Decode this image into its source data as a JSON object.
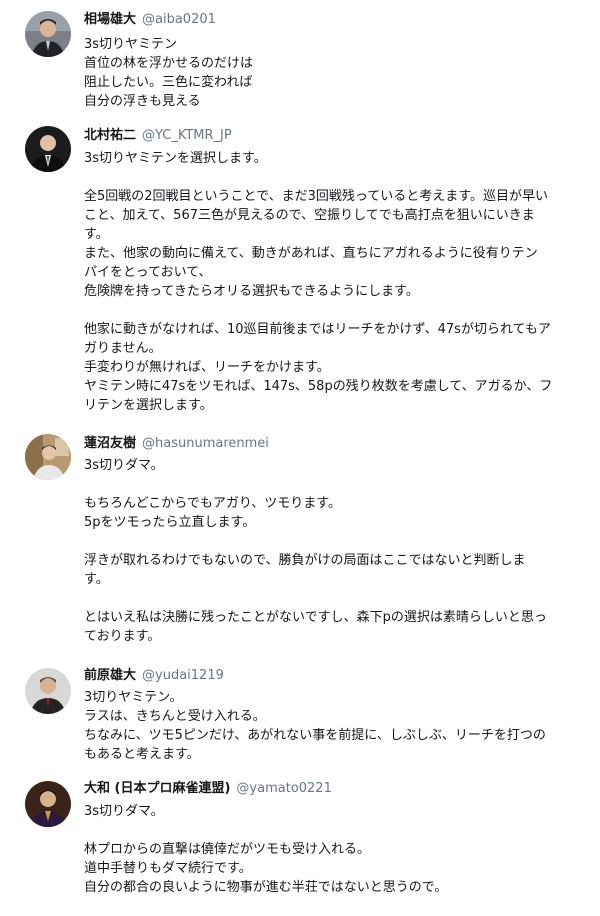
{
  "tweets": [
    {
      "name": "相場雄大",
      "handle": "@aiba0201",
      "avatar": "avatar-man-suit",
      "lines": [
        "3s切りヤミテン",
        "首位の林を浮かせるのだけは",
        "阻止したい。三色に変われば",
        "自分の浮きも見える"
      ]
    },
    {
      "name": "北村祐二",
      "handle": "@YC_KTMR_JP",
      "avatar": "avatar-man-dark-suit",
      "lines": [
        "3s切りヤミテンを選択します。",
        "",
        "全5回戦の2回戦目ということで、まだ3回戦残っていると考えます。巡目が早い",
        "こと、加えて、567三色が見えるので、空振りしてでも高打点を狙いにいきま",
        "す。",
        "また、他家の動向に備えて、動きがあれば、直ちにアガれるように役有りテン",
        "パイをとっておいて、",
        "危険牌を持ってきたらオリる選択もできるようにします。",
        "",
        "他家に動きがなければ、10巡目前後まではリーチをかけず、47sが切られてもア",
        "ガりません。",
        "手変わりが無ければ、リーチをかけます。",
        "ヤミテン時に47sをツモれば、147s、58pの残り枚数を考慮して、アガるか、フ",
        "リテンを選択します。"
      ]
    },
    {
      "name": "蓮沼友樹",
      "handle": "@hasunumarenmei",
      "avatar": "avatar-man-room",
      "lines": [
        "3s切りダマ。",
        "",
        "もちろんどこからでもアガり、ツモります。",
        "5pをツモったら立直します。",
        "",
        "浮きが取れるわけでもないので、勝負がけの局面はここではないと判断しま",
        "す。",
        "",
        "とはいえ私は決勝に残ったことがないですし、森下pの選択は素晴らしいと思っ",
        "ております。"
      ]
    },
    {
      "name": "前原雄大",
      "handle": "@yudai1219",
      "avatar": "avatar-man-older",
      "lines": [
        "3切りヤミテン。",
        "ラスは、きちんと受け入れる。",
        "ちなみに、ツモ5ピンだけ、あがれない事を前提に、しぶしぶ、リーチを打つの",
        "もあると考えます。"
      ]
    },
    {
      "name": "大和 (日本プロ麻雀連盟)",
      "handle": "@yamato0221",
      "avatar": "avatar-man-formal",
      "lines": [
        "3s切りダマ。",
        "",
        "林プロからの直撃は僥倖だがツモも受け入れる。",
        "道中手替りもダマ続行です。",
        "自分の都合の良いように物事が進む半荘ではないと思うので。"
      ]
    }
  ]
}
